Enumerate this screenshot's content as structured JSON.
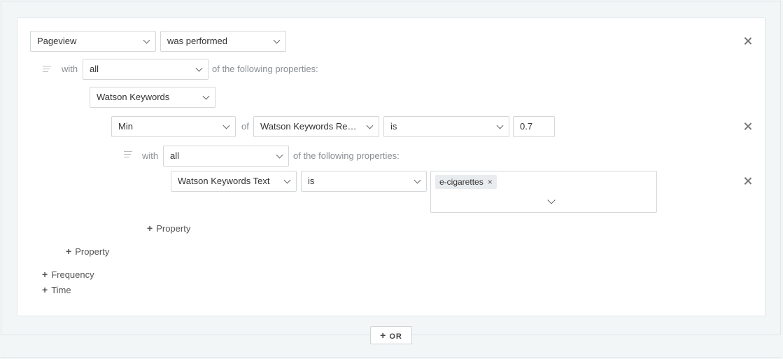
{
  "event_row": {
    "event": "Pageview",
    "condition": "was performed"
  },
  "with_row_1": {
    "with_label": "with",
    "quantifier": "all",
    "suffix": "of the following properties:"
  },
  "property_1": {
    "name": "Watson Keywords"
  },
  "aggregate_row": {
    "function": "Min",
    "of_label": "of",
    "field": "Watson Keywords Relevance",
    "operator": "is",
    "value": "0.7"
  },
  "with_row_2": {
    "with_label": "with",
    "quantifier": "all",
    "suffix": "of the following properties:"
  },
  "property_2": {
    "name": "Watson Keywords Text",
    "operator": "is",
    "tags": [
      "e-cigarettes"
    ]
  },
  "add_property_inner": "Property",
  "add_property_outer": "Property",
  "add_frequency": "Frequency",
  "add_time": "Time",
  "or_button": "OR",
  "icons": {
    "close": "close-icon",
    "drag": "drag-lines-icon",
    "plus": "plus-icon",
    "chevron": "chevron-down-icon"
  }
}
